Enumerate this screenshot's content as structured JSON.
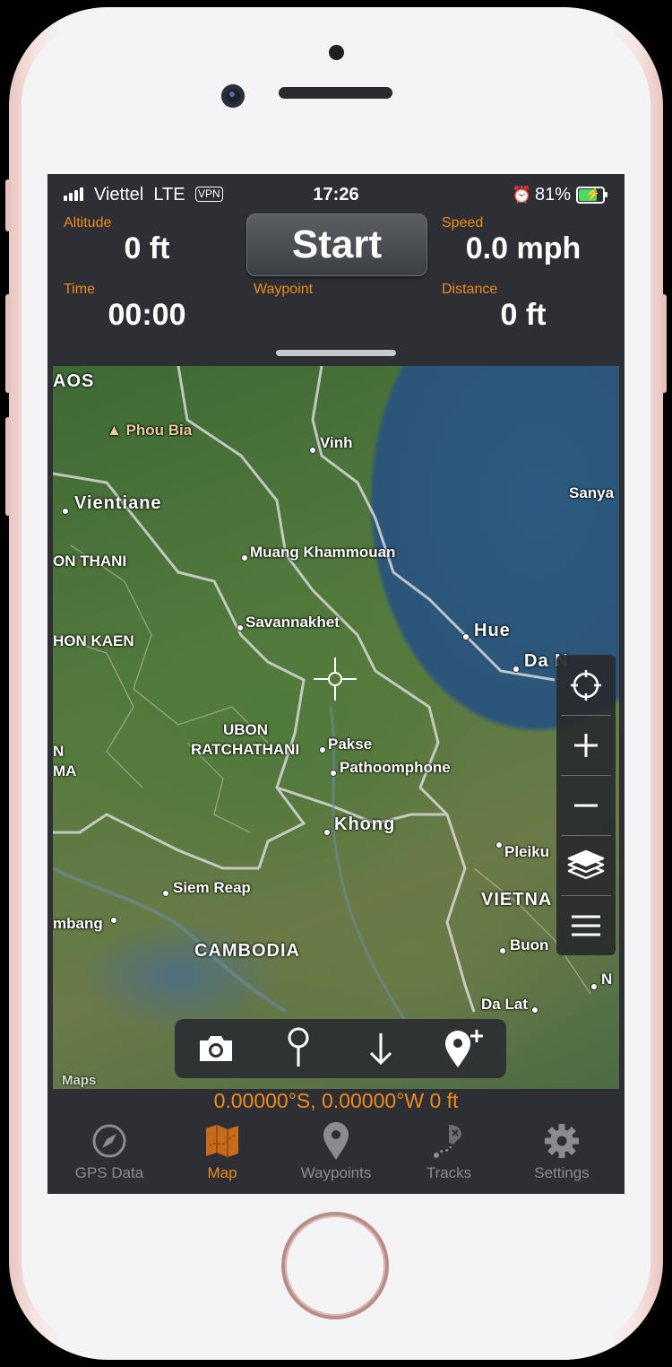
{
  "status_bar": {
    "carrier": "Viettel",
    "network": "LTE",
    "vpn": "VPN",
    "time": "17:26",
    "battery": "81%"
  },
  "panel": {
    "altitude_label": "Altitude",
    "altitude_value": "0 ft",
    "speed_label": "Speed",
    "speed_value": "0.0 mph",
    "time_label": "Time",
    "time_value": "00:00",
    "waypoint_label": "Waypoint",
    "distance_label": "Distance",
    "distance_value": "0 ft",
    "start_label": "Start"
  },
  "map": {
    "labels": [
      "AOS",
      "Phou Bia",
      "Vinh",
      "Sanya",
      "Vientiane",
      "ON THANI",
      "Muang Khammouan",
      "HON KAEN",
      "Savannakhet",
      "Hue",
      "Da N",
      "UBON",
      "RATCHATHANI",
      "N",
      "MA",
      "Pakse",
      "Pathoomphone",
      "Khong",
      "Pleiku",
      "Siem Reap",
      "VIETNA",
      "mbang",
      "CAMBODIA",
      "Buon",
      "N",
      "Da Lat"
    ],
    "attribution": "Maps"
  },
  "coordinates": "0.00000°S, 0.00000°W  0 ft",
  "tabs": [
    {
      "label": "GPS Data",
      "icon": "compass-icon"
    },
    {
      "label": "Map",
      "icon": "map-icon"
    },
    {
      "label": "Waypoints",
      "icon": "pin-icon"
    },
    {
      "label": "Tracks",
      "icon": "tracks-icon"
    },
    {
      "label": "Settings",
      "icon": "gear-icon"
    }
  ],
  "active_tab": "Map",
  "colors": {
    "accent": "#f08a1c",
    "panel": "#2d2f34",
    "phone_frame": "#f4f3f5"
  }
}
